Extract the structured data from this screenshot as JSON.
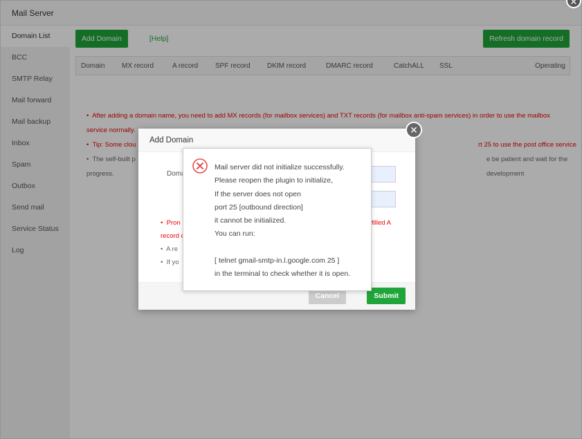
{
  "window": {
    "title": "Mail Server"
  },
  "sidebar": {
    "items": [
      "Domain List",
      "BCC",
      "SMTP Relay",
      "Mail forward",
      "Mail backup",
      "Inbox",
      "Spam",
      "Outbox",
      "Send mail",
      "Service Status",
      "Log"
    ]
  },
  "toolbar": {
    "add_domain": "Add Domain",
    "help": "[Help]",
    "refresh": "Refresh domain record"
  },
  "table": {
    "columns": [
      "Domain",
      "MX record",
      "A record",
      "SPF record",
      "DKIM record",
      "DMARC record",
      "CatchALL",
      "SSL",
      "Operating"
    ]
  },
  "notes": [
    "After adding a domain name, you need to add MX records (for mailbox services) and TXT records (for mailbox anti-spam services) in order to use the mailbox service normally.",
    "Tip: Some clou",
    "rt 25 to use the post office service",
    "The self-built p",
    "e be patient and wait for the development",
    "progress."
  ],
  "dialog": {
    "title": "Add Domain",
    "label": "Doma",
    "note1a": "Pron",
    "note1b": "filled A",
    "note1c": "record c",
    "note2": "A re",
    "note3": "If yo",
    "cancel": "Cancel",
    "submit": "Submit"
  },
  "message": {
    "icon": "error-circle-icon",
    "lines": "Mail server did not initialize successfully.\nPlease reopen the plugin to initialize,\nIf the server does not open\nport 25 [outbound direction]\nit cannot be initialized.\nYou can run:\n\n[ telnet gmail-smtp-in.l.google.com 25 ]\nin the terminal to check whether it is open."
  }
}
